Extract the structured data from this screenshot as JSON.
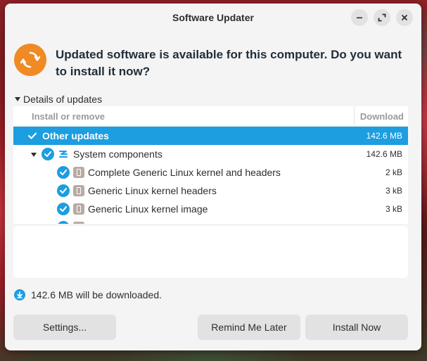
{
  "window": {
    "title": "Software Updater",
    "controls": [
      "minimize",
      "maximize",
      "close"
    ]
  },
  "header": {
    "icon": "software-updater-icon",
    "headline": "Updated software is available for this computer. Do you want to install it now?"
  },
  "details": {
    "toggle_label": "Details of updates",
    "expanded": true,
    "columns": {
      "name": "Install or remove",
      "download": "Download"
    },
    "rows": [
      {
        "label": "Other updates",
        "size": "142.6 MB",
        "selected": true,
        "checked": true
      },
      {
        "label": "System components",
        "size": "142.6 MB",
        "expanded": true,
        "checked": true,
        "icon": "system-components-icon"
      },
      {
        "label": "Complete Generic Linux kernel and headers",
        "size": "2 kB",
        "checked": true,
        "icon": "package-icon"
      },
      {
        "label": "Generic Linux kernel headers",
        "size": "3 kB",
        "checked": true,
        "icon": "package-icon"
      },
      {
        "label": "Generic Linux kernel image",
        "size": "3 kB",
        "checked": true,
        "icon": "package-icon"
      }
    ]
  },
  "status": {
    "icon": "download-icon",
    "text": "142.6 MB will be downloaded."
  },
  "buttons": {
    "settings": "Settings...",
    "remind": "Remind Me Later",
    "install": "Install Now"
  },
  "colors": {
    "accent": "#1c9ee0",
    "updater_icon": "#f08a24",
    "window_bg": "#f4f4f4"
  }
}
